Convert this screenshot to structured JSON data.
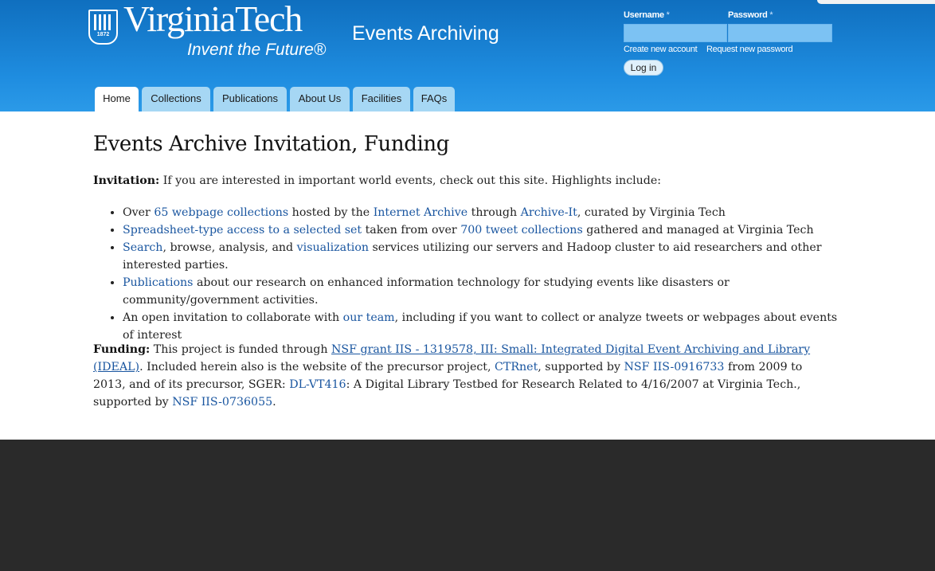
{
  "header": {
    "logo": {
      "wordmark": "VirginiaTech",
      "year": "1872",
      "tagline": "Invent the Future®"
    },
    "site_title": "Events Archiving",
    "login": {
      "username_label": "Username",
      "password_label": "Password",
      "required_mark": "*",
      "username_value": "",
      "password_value": "",
      "create_account": "Create new account",
      "request_password": "Request new password",
      "login_button": "Log in"
    },
    "tabs": [
      "Home",
      "Collections",
      "Publications",
      "About Us",
      "Facilities",
      "FAQs"
    ],
    "active_tab": "Home"
  },
  "main": {
    "title": "Events Archive Invitation, Funding",
    "intro": {
      "label": "Invitation:",
      "text": " If you are interested in important world events, check out this site. Highlights include:"
    },
    "highlights": [
      {
        "t1": "Over ",
        "link1": "65 webpage collections",
        "t2": " hosted by the ",
        "link2": "Internet Archive",
        "t3": " through ",
        "link3": "Archive-It",
        "t4": ", curated by Virginia Tech"
      },
      {
        "link1": "Spreadsheet-type access to a selected set",
        "t2": " taken from over ",
        "link2": "700 tweet collections",
        "t3": " gathered and managed at Virginia Tech"
      },
      {
        "link1": "Search",
        "t2": ", browse, analysis, and ",
        "link2": "visualization",
        "t3": " services utilizing our servers and Hadoop cluster to aid researchers and other interested parties."
      },
      {
        "link1": "Publications",
        "t2": " about our research on enhanced information technology for studying events like disasters or community/government activities."
      },
      {
        "t1": "An open invitation to collaborate with ",
        "link1": "our team",
        "t2": ", including if you want to collect or analyze tweets or webpages about events of interest"
      }
    ],
    "funding": {
      "label": "Funding:",
      "t1": " This project is funded through ",
      "link1": "NSF grant IIS - 1319578, III: Small: Integrated Digital Event Archiving and Library (IDEAL)",
      "t2": ". Included herein also is the website of the precursor project, ",
      "link2": "CTRnet",
      "t3": ", supported by ",
      "link3": "NSF IIS-0916733",
      "t4": " from 2009 to 2013, and of its precursor, SGER: ",
      "link4": "DL-VT416",
      "t5": ": A Digital Library Testbed for Research Related to 4/16/2007 at Virginia Tech., supported by ",
      "link5": "NSF IIS-0736055",
      "t6": "."
    }
  },
  "colors": {
    "header_top": "#0f6fbf",
    "header_bottom": "#2b9ae8",
    "tab_bg": "#a6d7f4",
    "link": "#1a56a0",
    "footer": "#2a2a2a"
  }
}
